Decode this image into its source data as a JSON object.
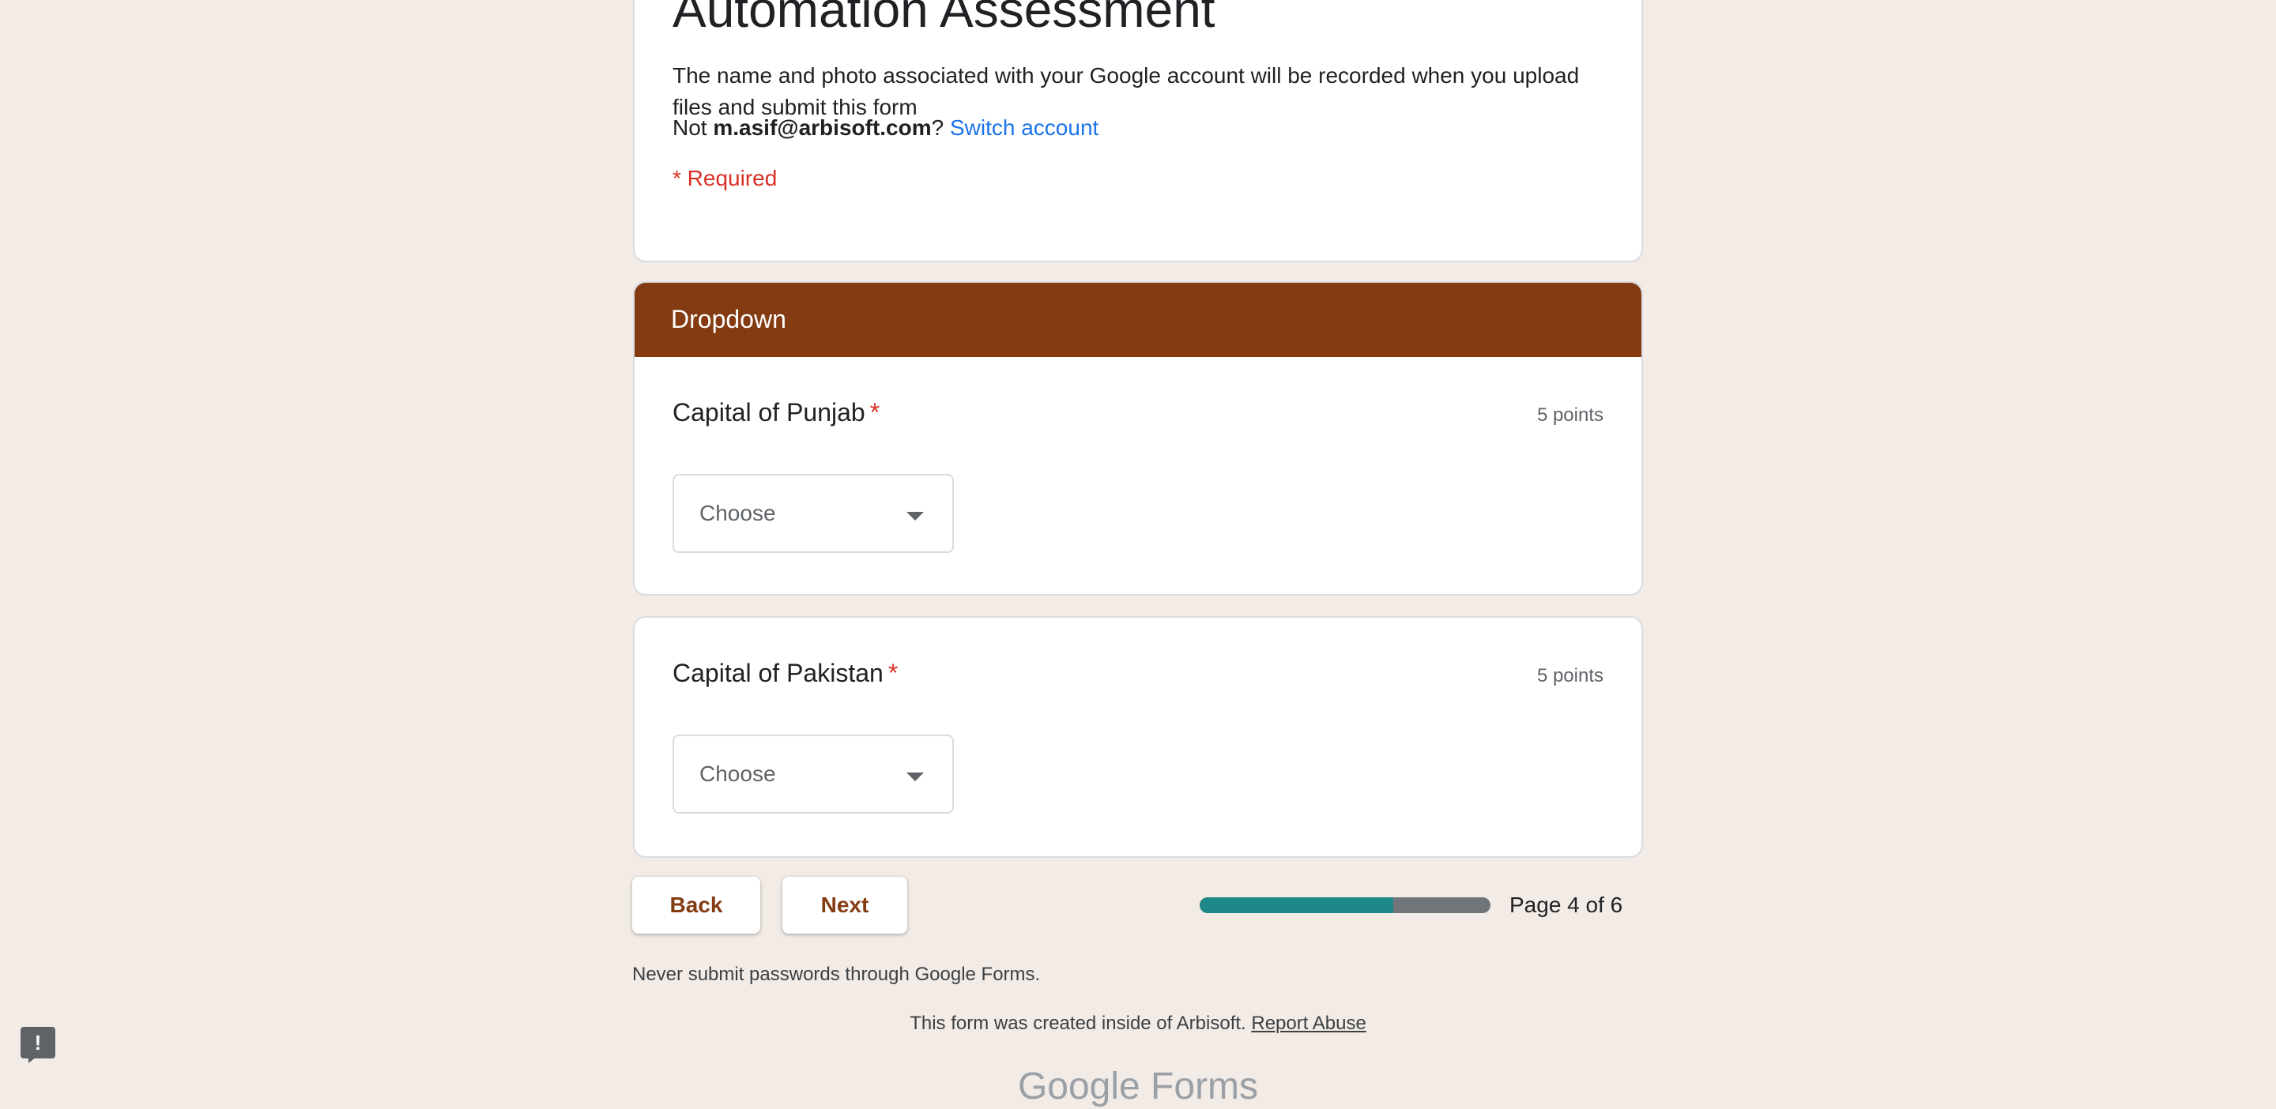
{
  "form": {
    "title": "Automation Assessment",
    "account_notice": "The name and photo associated with your Google account will be recorded when you upload files and submit this form",
    "not_prefix": "Not ",
    "account_email": "m.asif@arbisoft.com",
    "not_suffix": "? ",
    "switch_account": "Switch account",
    "required_note": "* Required"
  },
  "section": {
    "title": "Dropdown",
    "color": "#843b11"
  },
  "questions": [
    {
      "title": "Capital of Punjab",
      "required_mark": "*",
      "points": "5 points",
      "dropdown_value": "Choose"
    },
    {
      "title": "Capital of Pakistan",
      "required_mark": "*",
      "points": "5 points",
      "dropdown_value": "Choose"
    }
  ],
  "navigation": {
    "back_label": "Back",
    "next_label": "Next",
    "page_label": "Page 4 of 6",
    "progress_fraction": 0.667,
    "progress_color": "#1e8787"
  },
  "footer": {
    "password_warning": "Never submit passwords through Google Forms.",
    "created_inside": "This form was created inside of Arbisoft. ",
    "report_abuse": "Report Abuse",
    "logo_text": "Google Forms",
    "feedback_icon": "report-problem-icon"
  }
}
